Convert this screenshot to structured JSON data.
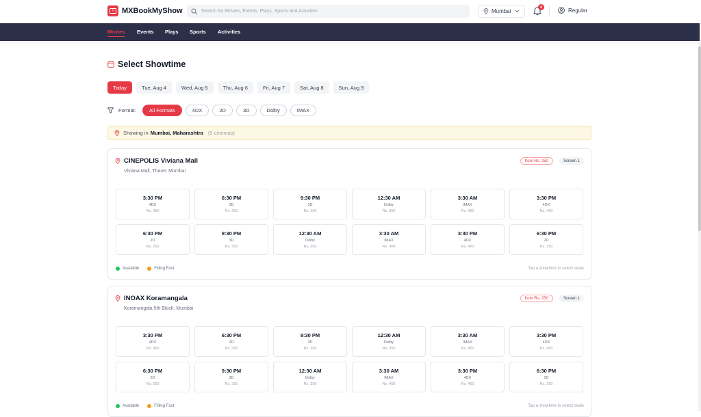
{
  "brand": {
    "name": "MXBookMyShow",
    "icon": "ticket-icon",
    "color": "#e63946"
  },
  "search": {
    "placeholder": "Search for Movies, Events, Plays, Sports and Activities"
  },
  "city": {
    "label": "Mumbai"
  },
  "notifications": {
    "count": "4"
  },
  "user": {
    "label": "Regular"
  },
  "nav": {
    "items": [
      "Movies",
      "Events",
      "Plays",
      "Sports",
      "Activities"
    ],
    "active": "Movies"
  },
  "page": {
    "title": "Select Showtime"
  },
  "dates": [
    "Today",
    "Tue, Aug 4",
    "Wed, Aug 5",
    "Thu, Aug 6",
    "Fri, Aug 7",
    "Sat, Aug 8",
    "Sun, Aug 9"
  ],
  "formats": {
    "label": "Format:",
    "options": [
      "All Formats",
      "4DX",
      "2D",
      "3D",
      "Dolby",
      "IMAX"
    ]
  },
  "location": {
    "prefix": "Showing in",
    "place": "Mumbai, Maharashtra",
    "count": "(5 cinemas)"
  },
  "cinemas": [
    {
      "name": "CINEPOLIS Viviana Mall",
      "address": "Viviana Mall, Thane, Mumbai",
      "price_from": "from Rs. 250",
      "screen": "Screen 1",
      "legend_available": "Available",
      "legend_filling": "Filling Fast",
      "hint": "Tap a showtime to select seats",
      "slots": [
        {
          "time": "3:30 PM",
          "format": "4DX",
          "price": "Rs. 450"
        },
        {
          "time": "6:30 PM",
          "format": "2D",
          "price": "Rs. 250"
        },
        {
          "time": "9:30 PM",
          "format": "3D",
          "price": "Rs. 300"
        },
        {
          "time": "12:30 AM",
          "format": "Dolby",
          "price": "Rs. 350"
        },
        {
          "time": "3:30 AM",
          "format": "IMAX",
          "price": "Rs. 450"
        },
        {
          "time": "3:30 PM",
          "format": "4DX",
          "price": "Rs. 450"
        },
        {
          "time": "6:30 PM",
          "format": "2D",
          "price": "Rs. 250"
        },
        {
          "time": "9:30 PM",
          "format": "3D",
          "price": "Rs. 300"
        },
        {
          "time": "12:30 AM",
          "format": "Dolby",
          "price": "Rs. 350"
        },
        {
          "time": "3:30 AM",
          "format": "IMAX",
          "price": "Rs. 400"
        },
        {
          "time": "3:30 PM",
          "format": "4DX",
          "price": "Rs. 450"
        },
        {
          "time": "6:30 PM",
          "format": "2D",
          "price": "Rs. 250"
        }
      ]
    },
    {
      "name": "INOAX Koramangala",
      "address": "Koramangala 5th Block, Mumbai",
      "price_from": "from Rs. 250",
      "screen": "Screen 1",
      "legend_available": "Available",
      "legend_filling": "Filling Fast",
      "hint": "Tap a showtime to select seats",
      "slots": [
        {
          "time": "3:30 PM",
          "format": "4DX",
          "price": "Rs. 450"
        },
        {
          "time": "6:30 PM",
          "format": "2D",
          "price": "Rs. 250"
        },
        {
          "time": "9:30 PM",
          "format": "3D",
          "price": "Rs. 300"
        },
        {
          "time": "12:30 AM",
          "format": "Dolby",
          "price": "Rs. 350"
        },
        {
          "time": "3:30 AM",
          "format": "IMAX",
          "price": "Rs. 400"
        },
        {
          "time": "3:30 PM",
          "format": "4DX",
          "price": "Rs. 450"
        },
        {
          "time": "6:30 PM",
          "format": "2D",
          "price": "Rs. 250"
        },
        {
          "time": "9:30 PM",
          "format": "3D",
          "price": "Rs. 350"
        },
        {
          "time": "12:30 AM",
          "format": "Dolby",
          "price": "Rs. 350"
        },
        {
          "time": "3:30 AM",
          "format": "IMAX",
          "price": "Rs. 400"
        },
        {
          "time": "3:30 PM",
          "format": "4DX",
          "price": "Rs. 450"
        },
        {
          "time": "6:30 PM",
          "format": "2D",
          "price": "Rs. 250"
        }
      ]
    }
  ],
  "colors": {
    "accent": "#e63946",
    "nav_bg": "#2b2f48",
    "available": "#22c55e",
    "filling": "#f59e0b"
  }
}
